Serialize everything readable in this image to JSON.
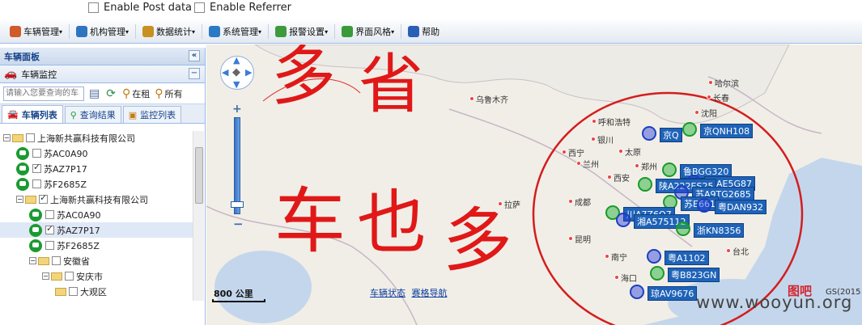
{
  "options": {
    "enable_post": "Enable Post data",
    "enable_referrer": "Enable Referrer"
  },
  "menubar": [
    {
      "label": "车辆管理",
      "icon": "vehicle-icon",
      "color": "#d05a2a"
    },
    {
      "label": "机构管理",
      "icon": "globe-icon",
      "color": "#2f74c0"
    },
    {
      "label": "数据统计",
      "icon": "bar-chart-icon",
      "color": "#c89020"
    },
    {
      "label": "系统管理",
      "icon": "gear-icon",
      "color": "#2a7bc4"
    },
    {
      "label": "报警设置",
      "icon": "alarm-icon",
      "color": "#3d9a3d"
    },
    {
      "label": "界面风格",
      "icon": "palette-icon",
      "color": "#3a9a3a"
    },
    {
      "label": "帮助",
      "icon": "help-icon",
      "color": "#2a5fb8"
    }
  ],
  "panel": {
    "title": "车辆面板",
    "collapse_glyph": "«",
    "sub_title": "车辆监控",
    "sub_glyph": "−",
    "search_placeholder": "请输入您要查询的车",
    "tool_rent": "在租",
    "tool_all": "所有",
    "tabs": [
      "车辆列表",
      "查询结果",
      "监控列表"
    ]
  },
  "tree": [
    {
      "level": 0,
      "type": "folder",
      "label": "上海新共赢科技有限公司",
      "exp": "−"
    },
    {
      "level": 1,
      "type": "car",
      "label": "苏AC0A90",
      "checked": false
    },
    {
      "level": 1,
      "type": "car",
      "label": "苏AZ7P17",
      "checked": true
    },
    {
      "level": 1,
      "type": "car",
      "label": "苏F2685Z",
      "checked": false
    },
    {
      "level": 1,
      "type": "folder",
      "label": "上海新共赢科技有限公司",
      "exp": "−",
      "checked": true
    },
    {
      "level": 2,
      "type": "car",
      "label": "苏AC0A90",
      "checked": false
    },
    {
      "level": 2,
      "type": "car",
      "label": "苏AZ7P17",
      "checked": true,
      "selected": true
    },
    {
      "level": 2,
      "type": "car",
      "label": "苏F2685Z",
      "checked": false
    },
    {
      "level": 2,
      "type": "folder",
      "label": "安徽省",
      "exp": "−"
    },
    {
      "level": 3,
      "type": "folder",
      "label": "安庆市",
      "exp": "−"
    },
    {
      "level": 4,
      "type": "folder",
      "label": "大观区"
    }
  ],
  "map": {
    "nav_glyph": "◆",
    "zoom_in": "+",
    "zoom_out": "−",
    "scale": "800 公里",
    "links": [
      "车辆状态",
      "赛格导航"
    ],
    "copyright": "GS(2015",
    "logo_text": "图吧",
    "handwriting": [
      "多",
      "省",
      "车",
      "也",
      "多"
    ],
    "cities": [
      "哈尔滨",
      "长春",
      "沈阳",
      "乌鲁木齐",
      "呼和浩特",
      "银川",
      "太原",
      "西宁",
      "兰州",
      "郑州",
      "西安",
      "成都",
      "拉萨",
      "昆明",
      "南宁",
      "海口",
      "台北"
    ],
    "vehicle_labels": [
      "京QNH108",
      "京Q",
      "鲁BGG320",
      "苏AE5G87",
      "陕A222ES25",
      "苏A9TG2685",
      "苏E661",
      "粤DAN932",
      "川A7Z6Q7",
      "湘A575112",
      "浙KN8356",
      "粤A1102",
      "粤B823GN",
      "琼AV9676"
    ]
  },
  "watermark": "www.wooyun.org"
}
